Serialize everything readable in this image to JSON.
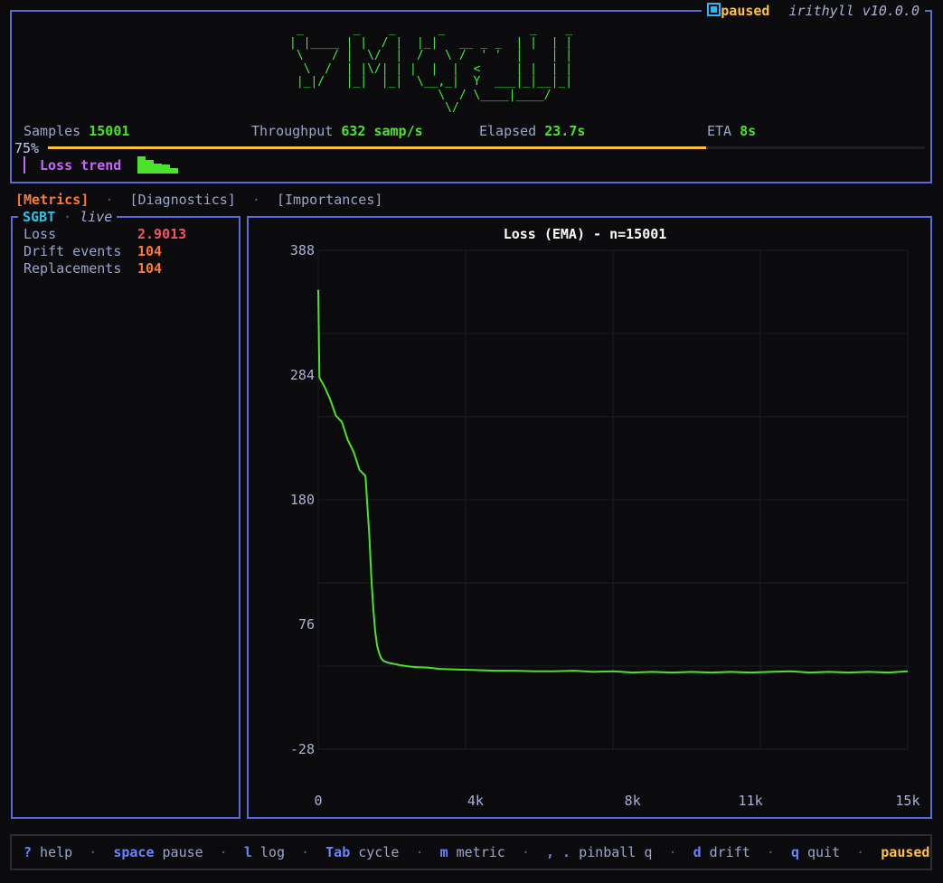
{
  "header": {
    "status": "paused",
    "app_version": "irithyll v10.0.0",
    "logo_ascii": " _       _    _      _            _    _\n| |____ | |  / |  |_|   __ _ _  | |  | |\n \\    / |  \\/  |  /   \\ /  ' '  |    | |\n  \\  /  | |\\/| | |  |  |  <     | |  | |\n |_|/   |_|  |_|  \\__,_|  Y  ___|_|__|_|\n                     \\  / \\____|____/\n                      \\/",
    "stats": {
      "samples_label": "Samples",
      "samples_value": "15001",
      "throughput_label": "Throughput",
      "throughput_value": "632 samp/s",
      "elapsed_label": "Elapsed",
      "elapsed_value": "23.7s",
      "eta_label": "ETA",
      "eta_value": "8s"
    },
    "progress_label": "75%",
    "progress_fraction": 0.75,
    "loss_trend_label": "Loss trend",
    "loss_trend_sparkline": [
      1.0,
      0.8,
      0.6,
      0.5,
      0.3
    ]
  },
  "tabs": [
    {
      "label": "[Metrics]",
      "active": true
    },
    {
      "label": "[Diagnostics]",
      "active": false
    },
    {
      "label": "[Importances]",
      "active": false
    }
  ],
  "metrics_panel": {
    "title": "SGBT",
    "subtitle": "live",
    "rows": [
      {
        "label": "Loss",
        "value": "2.9013",
        "color": "#f7525d"
      },
      {
        "label": "Drift events",
        "value": "104",
        "color": "#ff7a2e"
      },
      {
        "label": "Replacements",
        "value": "104",
        "color": "#ff7a2e"
      }
    ]
  },
  "chart_data": {
    "type": "line",
    "title": "Loss (EMA) - n=15001",
    "xlabel": "",
    "ylabel": "",
    "xlim": [
      0,
      15001
    ],
    "ylim": [
      -28,
      388
    ],
    "x_ticks": [
      {
        "value": 0,
        "label": "0"
      },
      {
        "value": 4000,
        "label": "4k"
      },
      {
        "value": 8000,
        "label": "8k"
      },
      {
        "value": 11000,
        "label": "11k"
      },
      {
        "value": 15000,
        "label": "15k"
      }
    ],
    "y_ticks": [
      {
        "value": 388,
        "label": "388"
      },
      {
        "value": 284,
        "label": "284"
      },
      {
        "value": 180,
        "label": "180"
      },
      {
        "value": 76,
        "label": "76"
      },
      {
        "value": -28,
        "label": "-28"
      }
    ],
    "grid": true,
    "series": [
      {
        "color": "#4ae32a",
        "x": [
          0,
          30,
          60,
          150,
          300,
          450,
          600,
          750,
          900,
          1050,
          1200,
          1300,
          1350,
          1400,
          1450,
          1500,
          1550,
          1600,
          1650,
          1700,
          1800,
          1950,
          2100,
          2300,
          2500,
          2800,
          3100,
          3500,
          4000,
          4500,
          5000,
          5500,
          6000,
          6500,
          7000,
          7500,
          8000,
          8500,
          9000,
          9500,
          10000,
          10500,
          11000,
          11500,
          12000,
          12500,
          13000,
          13500,
          14000,
          14500,
          15001
        ],
        "y": [
          355,
          282,
          280,
          275,
          264,
          250,
          245,
          230,
          220,
          205,
          200,
          150,
          115,
          90,
          70,
          58,
          52,
          48,
          46,
          45,
          44,
          43,
          42,
          41,
          40.5,
          40,
          39,
          38.5,
          38,
          37.5,
          37.5,
          37,
          37,
          37.5,
          36.5,
          37,
          36,
          36.5,
          36,
          36.5,
          36,
          36.5,
          36,
          36.5,
          37,
          36,
          36.5,
          36,
          36.5,
          36,
          37
        ]
      }
    ]
  },
  "footer": {
    "keys": [
      {
        "key": "?",
        "action": "help"
      },
      {
        "key": "space",
        "action": "pause"
      },
      {
        "key": "l",
        "action": "log"
      },
      {
        "key": "Tab",
        "action": "cycle"
      },
      {
        "key": "m",
        "action": "metric"
      },
      {
        "key": ", .",
        "action": "pinball q"
      },
      {
        "key": "d",
        "action": "drift"
      },
      {
        "key": "q",
        "action": "quit"
      }
    ],
    "status": "paused"
  }
}
